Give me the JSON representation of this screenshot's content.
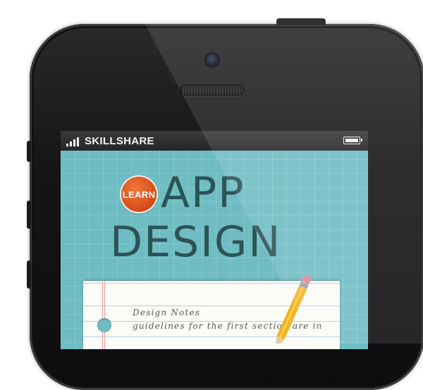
{
  "status_bar": {
    "carrier": "SKILLSHARE",
    "signal_icon": "signal-bars-icon",
    "battery_icon": "battery-full-icon"
  },
  "hero": {
    "badge_text": "LEARN",
    "title_line1": "APP",
    "title_line2": "DESIGN"
  },
  "notepad": {
    "line1": "Design Notes",
    "line2": "guidelines for the first section are in"
  },
  "colors": {
    "screen_bg": "#6fbcc3",
    "title": "#2c5356",
    "badge": "#e05a22",
    "phone_body": "#151516"
  }
}
